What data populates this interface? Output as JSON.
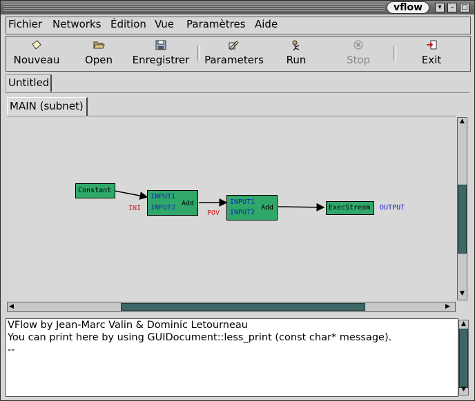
{
  "window": {
    "title": "vflow",
    "controls": [
      "▾",
      "–",
      "□",
      "✕"
    ]
  },
  "menu": [
    "Fichier",
    "Networks",
    "Édition",
    "Vue",
    "Paramètres",
    "Aide"
  ],
  "toolbar": [
    {
      "label": "Nouveau",
      "icon": "new-file-icon"
    },
    {
      "label": "Open",
      "icon": "open-folder-icon"
    },
    {
      "label": "Enregistrer",
      "icon": "floppy-disk-icon"
    },
    {
      "label": "Parameters",
      "icon": "parameters-icon"
    },
    {
      "label": "Run",
      "icon": "run-icon"
    },
    {
      "label": "Stop",
      "icon": "stop-icon",
      "disabled": true
    },
    {
      "label": "Exit",
      "icon": "exit-icon"
    }
  ],
  "document_tab": "Untitled",
  "subnet_tab": "MAIN (subnet)",
  "network": {
    "nodes": {
      "constant": {
        "label": "Constant"
      },
      "add1": {
        "inputs": [
          "INPUT1",
          "INPUT2"
        ],
        "output": "Add"
      },
      "add2": {
        "inputs": [
          "INPUT1",
          "INPUT2"
        ],
        "output": "Add"
      },
      "exec": {
        "label": "ExecStream"
      }
    },
    "terminals": {
      "ini": "INI",
      "pov": "POV",
      "output": "OUTPUT"
    }
  },
  "console": [
    "VFlow by Jean-Marc Valin & Dominic Letourneau",
    "You can print here by using GUIDocument::less_print (const char* message).",
    "--"
  ],
  "colors": {
    "node": "#2fa86a",
    "input_port": "#1a1ad0",
    "terminal_in": "#d01a1a",
    "terminal_out": "#1a1ad0",
    "scroll_thumb": "#3d6666"
  }
}
